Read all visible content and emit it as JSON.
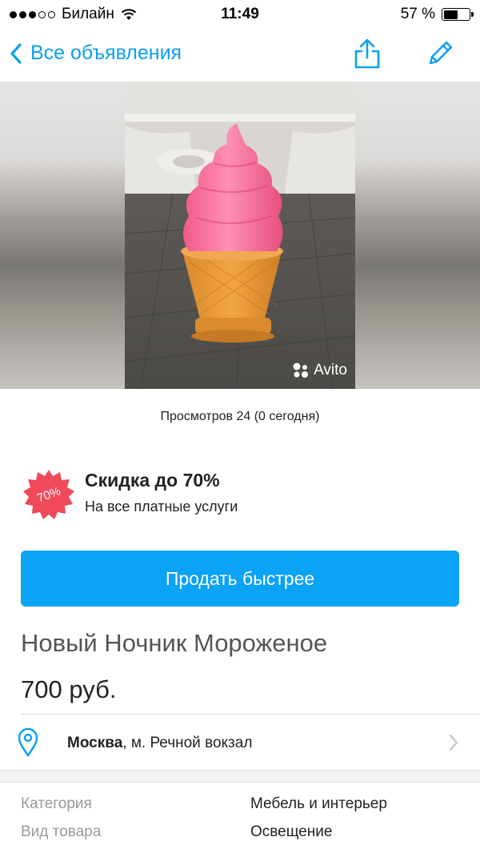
{
  "status_bar": {
    "carrier": "Билайн",
    "time": "11:49",
    "battery_label": "57 %",
    "battery_level": 0.57,
    "signal_bars_filled": 3,
    "signal_bars_total": 5
  },
  "nav": {
    "back_label": "Все объявления",
    "accent_color": "#0aa0f0",
    "icons": [
      "chevron-left-icon",
      "share-icon",
      "edit-pencil-icon"
    ]
  },
  "gallery": {
    "watermark": "Avito",
    "image_subject": "pink-ice-cream-lamp"
  },
  "views": "Просмотров 24 (0 сегодня)",
  "promo": {
    "badge": "70%",
    "title": "Скидка до 70%",
    "subtitle": "На все платные услуги",
    "badge_color": "#f04a5a"
  },
  "sell_button": "Продать быстрее",
  "listing": {
    "title": "Новый Ночник Мороженое",
    "price": "700 руб."
  },
  "location": {
    "city": "Москва",
    "metro": ", м. Речной вокзал"
  },
  "params": [
    {
      "key": "Категория",
      "value": "Мебель и интерьер"
    },
    {
      "key": "Вид товара",
      "value": "Освещение"
    }
  ]
}
